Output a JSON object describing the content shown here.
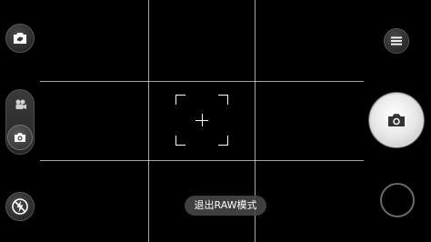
{
  "toast": {
    "text": "退出RAW模式"
  },
  "icons": {
    "switch_camera": "switch-camera-icon",
    "video_mode": "video-camera-icon",
    "photo_mode": "camera-icon",
    "flash": "flash-off-icon",
    "menu": "menu-icon",
    "shutter": "camera-icon",
    "gallery": "gallery-thumbnail"
  },
  "colors": {
    "background": "#000000",
    "grid": "#ffffff",
    "shutter": "#eeeeee",
    "toast_bg": "#464646"
  },
  "state": {
    "active_mode": "photo",
    "grid_enabled": true
  }
}
